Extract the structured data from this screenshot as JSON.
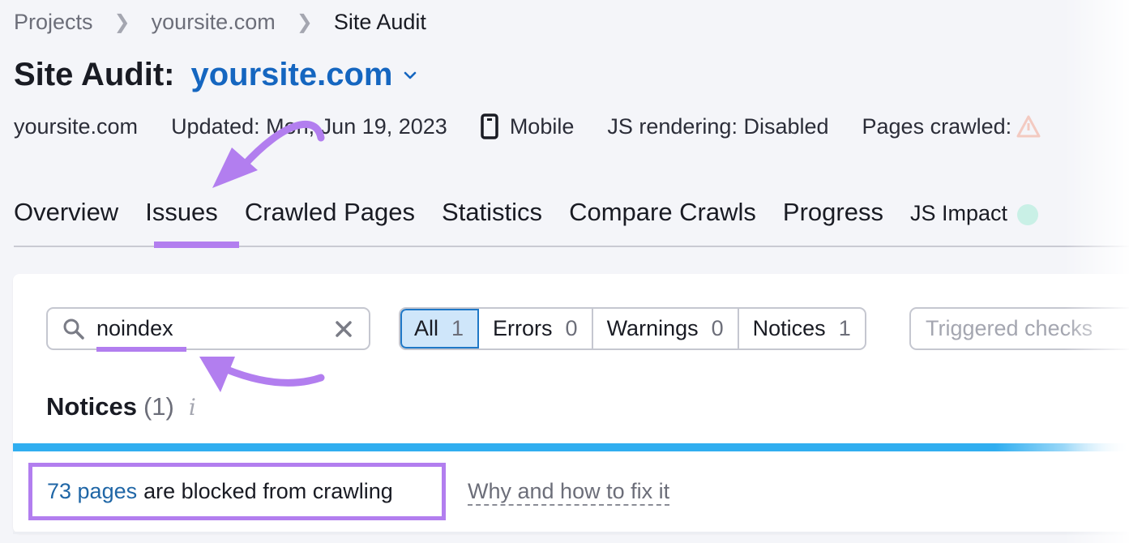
{
  "breadcrumb": [
    {
      "label": "Projects"
    },
    {
      "label": "yoursite.com"
    },
    {
      "label": "Site Audit"
    }
  ],
  "header": {
    "title_prefix": "Site Audit:",
    "title_domain": "yoursite.com"
  },
  "meta": {
    "domain": "yoursite.com",
    "updated": "Updated: Mon, Jun 19, 2023",
    "device": "Mobile",
    "js_rendering": "JS rendering: Disabled",
    "pages_crawled": "Pages crawled:"
  },
  "tabs": [
    {
      "label": "Overview"
    },
    {
      "label": "Issues",
      "active": true
    },
    {
      "label": "Crawled Pages"
    },
    {
      "label": "Statistics"
    },
    {
      "label": "Compare Crawls"
    },
    {
      "label": "Progress"
    },
    {
      "label": "JS Impact"
    }
  ],
  "search": {
    "value": "noindex"
  },
  "filters": [
    {
      "label": "All",
      "count": "1",
      "active": true
    },
    {
      "label": "Errors",
      "count": "0"
    },
    {
      "label": "Warnings",
      "count": "0"
    },
    {
      "label": "Notices",
      "count": "1"
    }
  ],
  "checks_select": {
    "placeholder": "Triggered checks"
  },
  "section": {
    "title": "Notices",
    "count": "(1)",
    "info": "i"
  },
  "issue": {
    "link": "73 pages",
    "text": "are blocked from crawling",
    "fix_link": "Why and how to fix it"
  },
  "colors": {
    "accent_blue": "#1566c0",
    "annotation_purple": "#b27eef",
    "notice_bar": "#30aef0"
  }
}
